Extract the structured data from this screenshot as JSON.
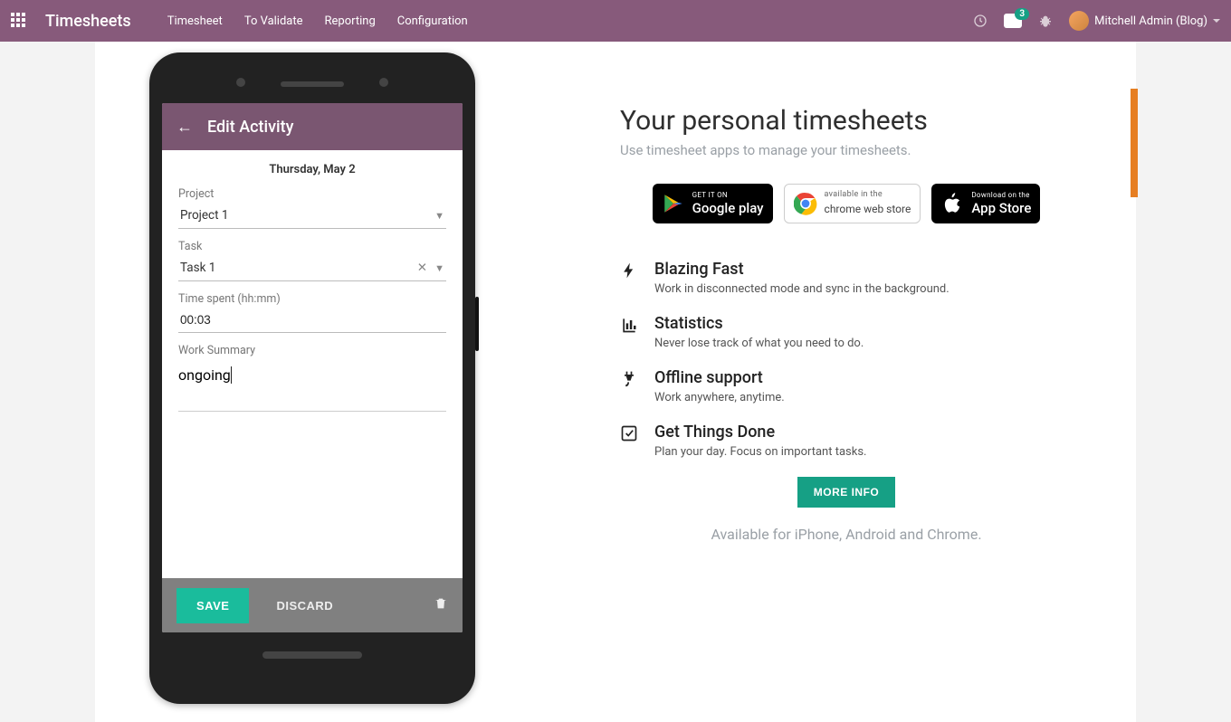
{
  "navbar": {
    "brand": "Timesheets",
    "menu": [
      "Timesheet",
      "To Validate",
      "Reporting",
      "Configuration"
    ],
    "chat_count": "3",
    "user": "Mitchell Admin (Blog)"
  },
  "phone": {
    "header": "Edit Activity",
    "date": "Thursday, May 2",
    "labels": {
      "project": "Project",
      "task": "Task",
      "time": "Time spent (hh:mm)",
      "summary": "Work Summary"
    },
    "fields": {
      "project": "Project 1",
      "task": "Task 1",
      "time": "00:03",
      "summary": "ongoing"
    },
    "buttons": {
      "save": "SAVE",
      "discard": "DISCARD"
    }
  },
  "info": {
    "title": "Your personal timesheets",
    "subtitle": "Use timesheet apps to manage your timesheets.",
    "stores": {
      "google_top": "GET IT ON",
      "google_main": "Google play",
      "chrome_top": "available in the",
      "chrome_main": "chrome web store",
      "apple_top": "Download on the",
      "apple_main": "App Store"
    },
    "features": [
      {
        "title": "Blazing Fast",
        "desc": "Work in disconnected mode and sync in the background."
      },
      {
        "title": "Statistics",
        "desc": "Never lose track of what you need to do."
      },
      {
        "title": "Offline support",
        "desc": "Work anywhere, anytime."
      },
      {
        "title": "Get Things Done",
        "desc": "Plan your day. Focus on important tasks."
      }
    ],
    "more": "MORE INFO",
    "avail": "Available for iPhone, Android and Chrome."
  }
}
